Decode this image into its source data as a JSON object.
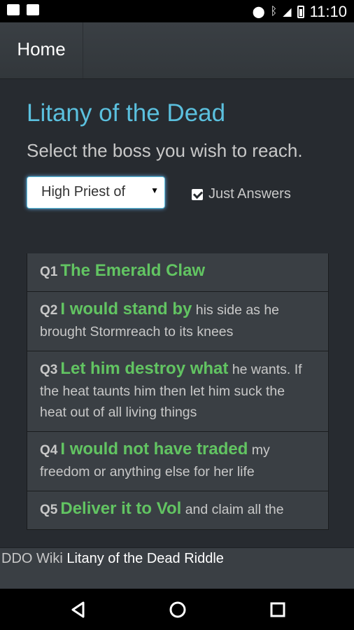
{
  "status_bar": {
    "time": "11:10",
    "icons": [
      "outlook-icon",
      "image-icon",
      "location-icon",
      "bluetooth-icon",
      "signal-icon",
      "battery-icon"
    ]
  },
  "navbar": {
    "home_label": "Home"
  },
  "page": {
    "title": "Litany of the Dead",
    "subtitle": "Select the boss you wish to reach.",
    "boss_select_value": "High Priest of",
    "just_answers_label": "Just Answers",
    "just_answers_checked": true
  },
  "questions": [
    {
      "num": "Q1",
      "answer": "The Emerald Claw",
      "rest": ""
    },
    {
      "num": "Q2",
      "answer": "I would stand by",
      "rest": " his side as he brought Stormreach to its knees"
    },
    {
      "num": "Q3",
      "answer": "Let him destroy what",
      "rest": " he wants. If the heat taunts him then let him suck the heat out of all living things"
    },
    {
      "num": "Q4",
      "answer": "I would not have traded",
      "rest": " my freedom or anything else for her life"
    },
    {
      "num": "Q5",
      "answer": "Deliver it to Vol",
      "rest": " and claim all the"
    }
  ],
  "footer": {
    "wiki_label": "DDO Wiki",
    "link_label": "Litany of the Dead Riddle"
  },
  "colors": {
    "background": "#272b30",
    "title": "#5bc0de",
    "answer": "#62c462",
    "panel": "#3a3f44"
  }
}
